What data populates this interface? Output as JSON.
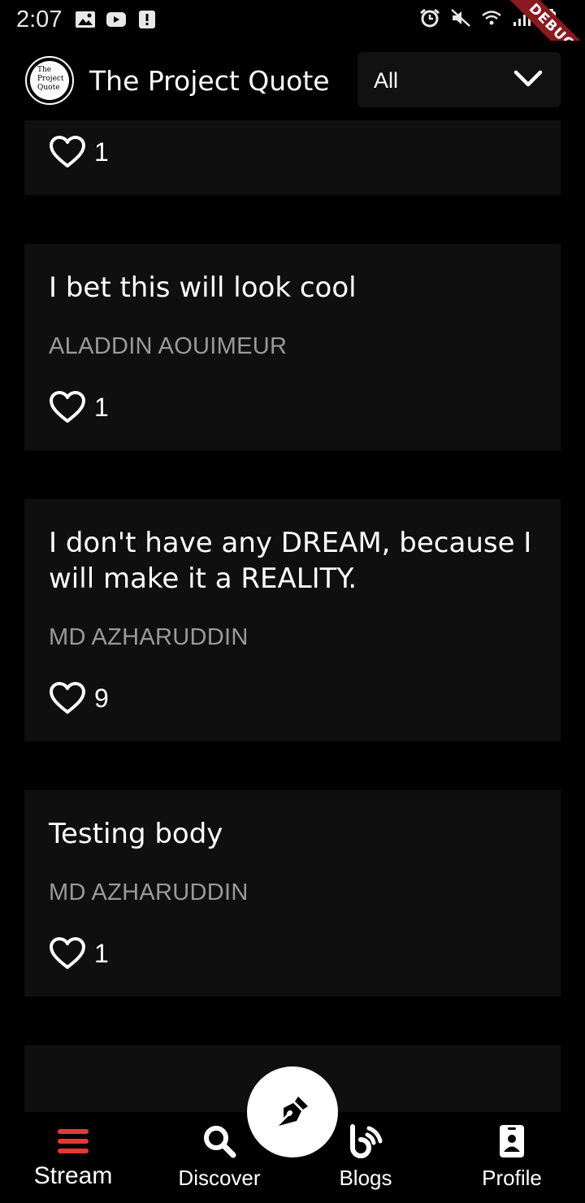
{
  "status_bar": {
    "time": "2:07",
    "left_icons": [
      "image-icon",
      "youtube-icon",
      "alert-icon"
    ],
    "right_icons": [
      "alarm-icon",
      "mute-icon",
      "wifi-icon",
      "signal-icon",
      "battery-icon"
    ],
    "debug_banner": "DEBUG"
  },
  "app_bar": {
    "logo_text": [
      "The",
      "Project",
      "Quote"
    ],
    "title": "The Project Quote",
    "filter": {
      "selected": "All"
    }
  },
  "feed": {
    "posts": [
      {
        "body": "",
        "author": "",
        "likes": "1"
      },
      {
        "body": "I bet this will look cool",
        "author": "ALADDIN AOUIMEUR",
        "likes": "1"
      },
      {
        "body": "I don't have any DREAM, because I will make it a REALITY.",
        "author": "MD AZHARUDDIN",
        "likes": "9"
      },
      {
        "body": "Testing body",
        "author": "MD AZHARUDDIN",
        "likes": "1"
      }
    ]
  },
  "fab": {
    "icon": "pen-nib-icon"
  },
  "bottom_nav": {
    "items": [
      {
        "label": "Stream",
        "icon": "stream-icon",
        "active": true
      },
      {
        "label": "Discover",
        "icon": "search-icon",
        "active": false
      },
      {
        "label": "Blogs",
        "icon": "blog-icon",
        "active": false
      },
      {
        "label": "Profile",
        "icon": "profile-icon",
        "active": false
      }
    ]
  },
  "colors": {
    "background": "#000000",
    "card": "#0f0f0f",
    "author_text": "#9a9a9a",
    "active_nav_icon": "#e53935",
    "debug_ribbon": "#8a1a1f"
  }
}
